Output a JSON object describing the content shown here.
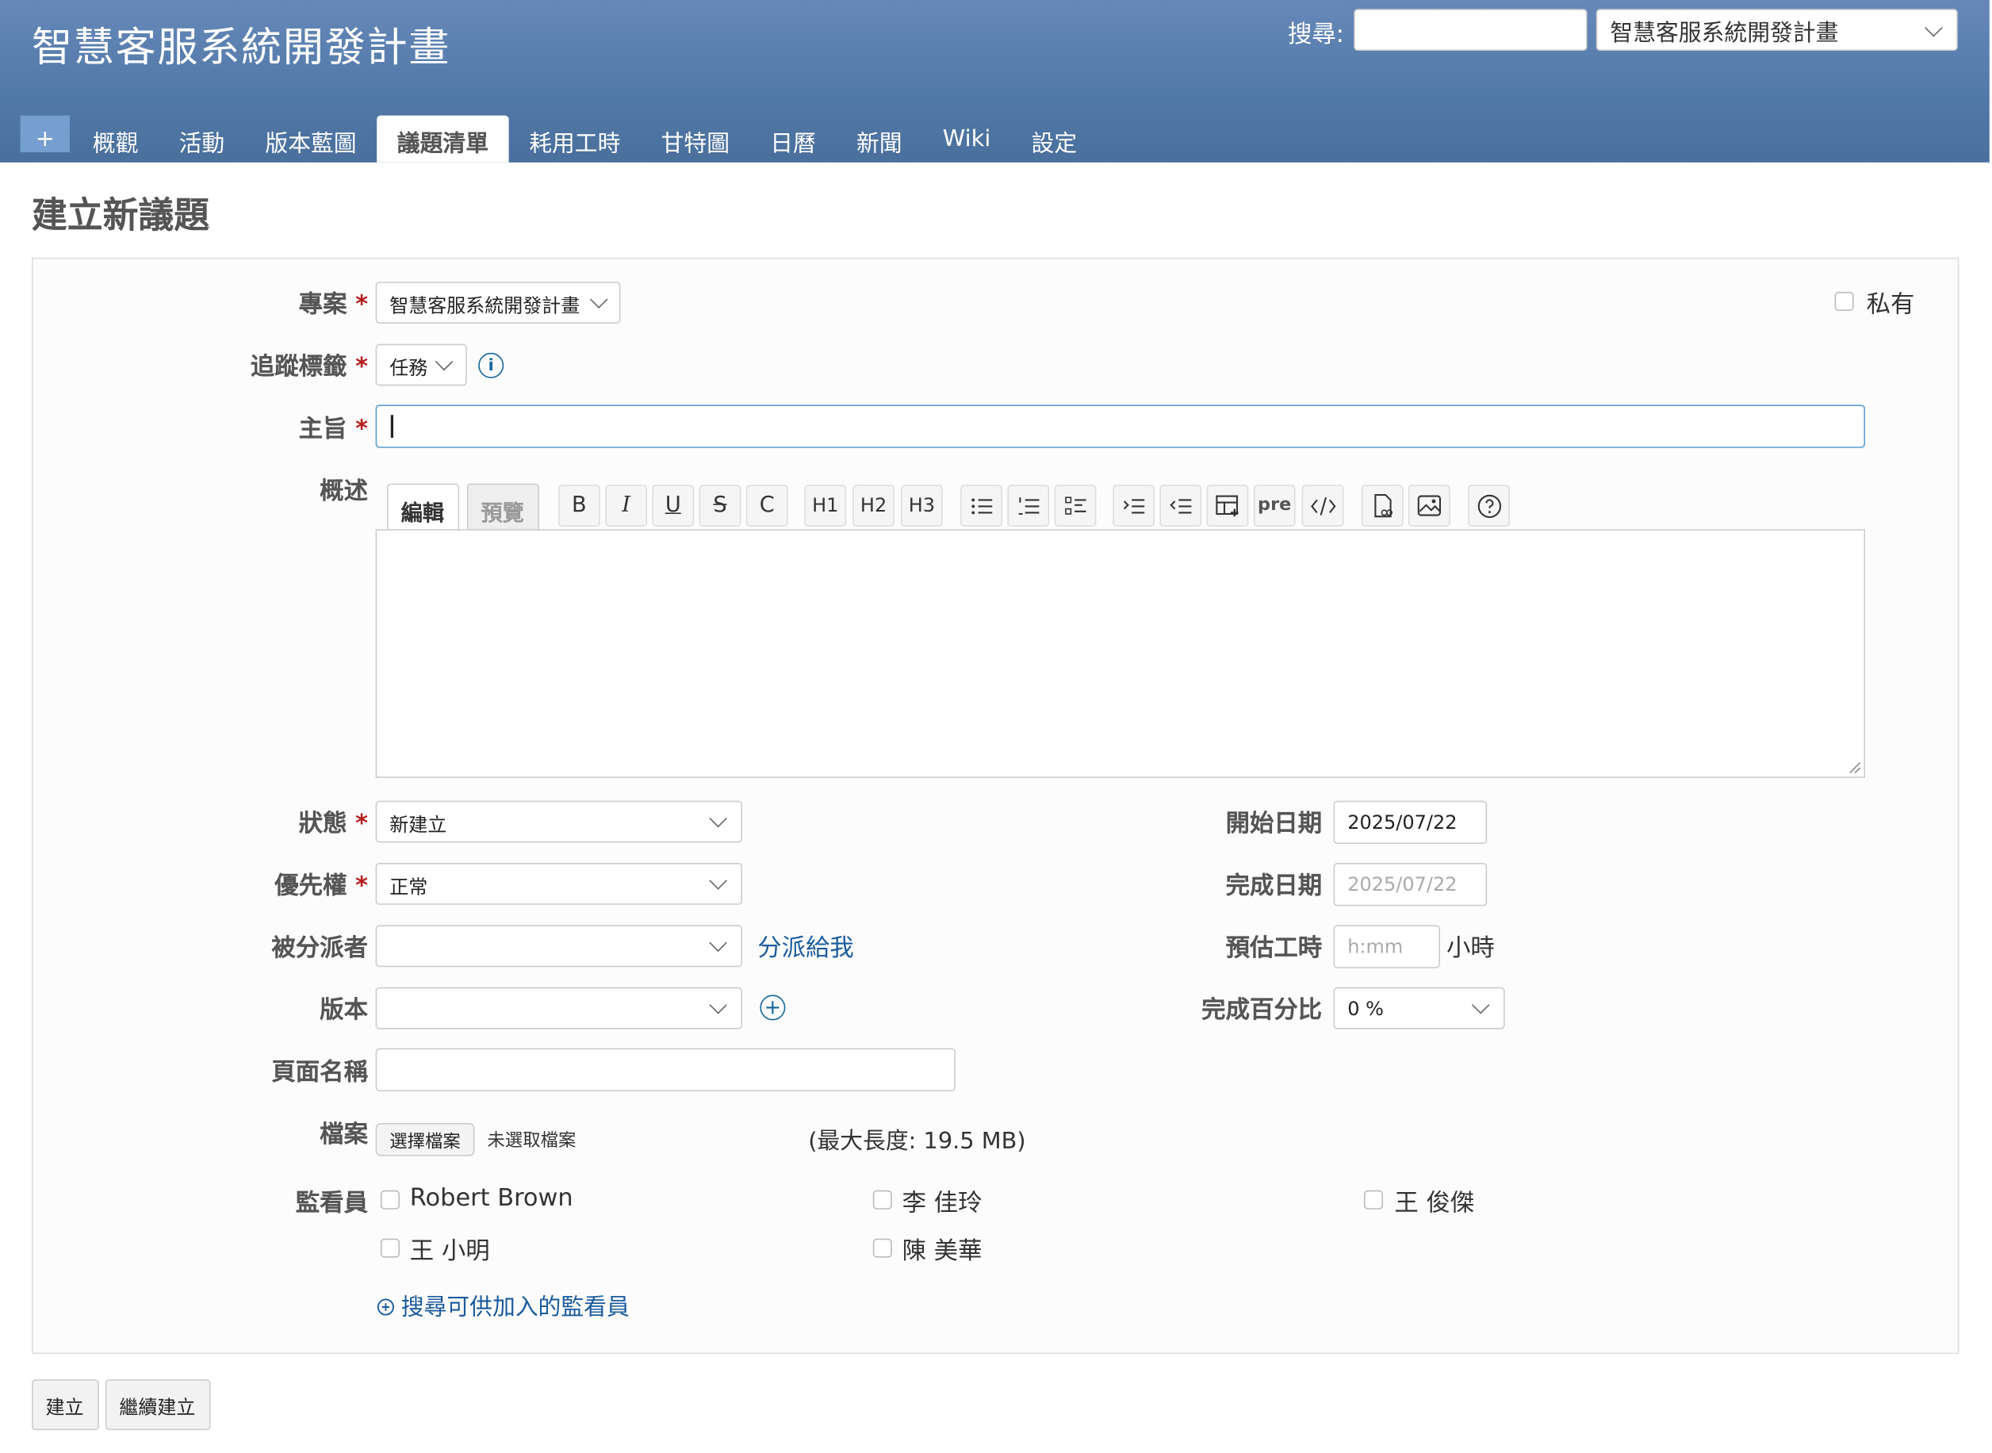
{
  "header": {
    "title": "智慧客服系統開發計畫",
    "search_label": "搜尋:",
    "search_value": "",
    "project_jump": "智慧客服系統開發計畫"
  },
  "tabs": [
    {
      "label": "+"
    },
    {
      "label": "概觀"
    },
    {
      "label": "活動"
    },
    {
      "label": "版本藍圖"
    },
    {
      "label": "議題清單"
    },
    {
      "label": "耗用工時"
    },
    {
      "label": "甘特圖"
    },
    {
      "label": "日曆"
    },
    {
      "label": "新聞"
    },
    {
      "label": "Wiki"
    },
    {
      "label": "設定"
    }
  ],
  "page_title": "建立新議題",
  "form": {
    "required_mark": "*",
    "project_label": "專案",
    "project_value": "智慧客服系統開發計畫",
    "private_label": "私有",
    "tracker_label": "追蹤標籤",
    "tracker_value": "任務",
    "info_icon_text": "i",
    "subject_label": "主旨",
    "subject_value": "",
    "description_label": "概述",
    "editor_tabs": {
      "edit": "編輯",
      "preview": "預覽"
    },
    "toolbar": [
      "B",
      "I",
      "U",
      "S",
      "C",
      "H1",
      "H2",
      "H3",
      "list-bullet",
      "list-numbered",
      "list-task",
      "indent",
      "outdent",
      "table",
      "pre",
      "code",
      "attachment",
      "image",
      "help"
    ],
    "toolbar_pre_label": "pre",
    "status_label": "狀態",
    "status_value": "新建立",
    "priority_label": "優先權",
    "priority_value": "正常",
    "assignee_label": "被分派者",
    "assignee_value": "",
    "assign_to_me": "分派給我",
    "version_label": "版本",
    "version_value": "",
    "version_add_icon": "+",
    "wiki_page_label": "頁面名稱",
    "wiki_page_value": "",
    "file_label": "檔案",
    "file_button": "選擇檔案",
    "file_none": "未選取檔案",
    "max_size": "(最大長度: 19.5 MB)",
    "start_date_label": "開始日期",
    "start_date_value": "2025/07/22",
    "due_date_label": "完成日期",
    "due_date_placeholder": "2025/07/22",
    "estimated_label": "預估工時",
    "estimated_placeholder": "h:mm",
    "hours_unit": "小時",
    "done_ratio_label": "完成百分比",
    "done_ratio_value": "0 %",
    "watchers_label": "監看員",
    "watchers": [
      "Robert Brown",
      "李 佳玲",
      "王 俊傑",
      "王 小明",
      "陳 美華"
    ],
    "search_watchers": "搜尋可供加入的監看員"
  },
  "buttons": {
    "create": "建立",
    "continue": "繼續建立"
  }
}
